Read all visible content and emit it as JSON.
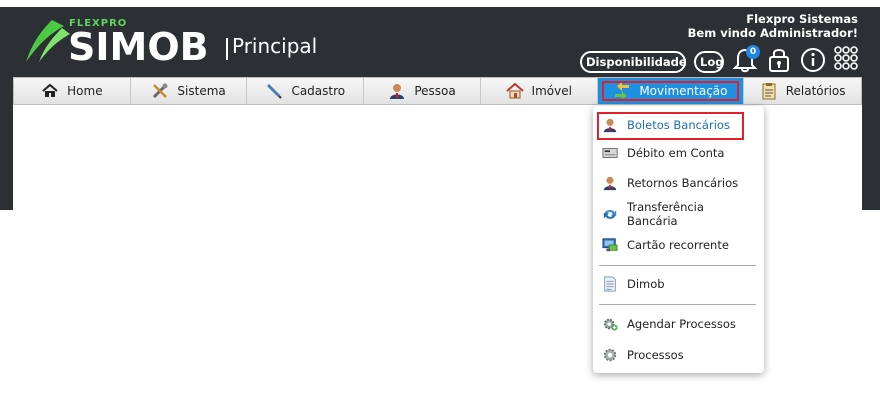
{
  "header": {
    "logo_small": "FLEXPRO",
    "logo_main": "SIMOB",
    "logo_page": "Principal",
    "company": "Flexpro Sistemas",
    "welcome": "Bem vindo Administrador!",
    "availability_button": "Disponibilidade",
    "log_button": "Log",
    "notification_count": "0",
    "icons": [
      "bell-icon",
      "lock-icon",
      "info-icon",
      "apps-grid-icon"
    ]
  },
  "nav": {
    "items": [
      {
        "label": "Home",
        "icon": "home-icon"
      },
      {
        "label": "Sistema",
        "icon": "tools-icon"
      },
      {
        "label": "Cadastro",
        "icon": "pen-icon"
      },
      {
        "label": "Pessoa",
        "icon": "person-icon"
      },
      {
        "label": "Imóvel",
        "icon": "house-icon"
      },
      {
        "label": "Movimentação",
        "icon": "exchange-icon",
        "active": true
      },
      {
        "label": "Relatórios",
        "icon": "report-icon"
      }
    ]
  },
  "dropdown": {
    "items": [
      {
        "label": "Boletos Bancários",
        "icon": "person-icon",
        "selected": true
      },
      {
        "label": "Débito em Conta",
        "icon": "card-icon"
      },
      {
        "label": "Retornos Bancários",
        "icon": "person-icon"
      },
      {
        "label": "Transferência Bancária",
        "icon": "transfer-icon"
      },
      {
        "label": "Cartão recorrente",
        "icon": "monitor-card-icon"
      },
      {
        "label": "Dimob",
        "icon": "document-icon"
      },
      {
        "label": "Agendar Processos",
        "icon": "gear-add-icon"
      },
      {
        "label": "Processos",
        "icon": "gear-icon"
      }
    ]
  },
  "colors": {
    "header_bg": "#2c2f33",
    "accent": "#1e90e0",
    "highlight": "#e0202a",
    "logo_green": "#5fd35a"
  }
}
